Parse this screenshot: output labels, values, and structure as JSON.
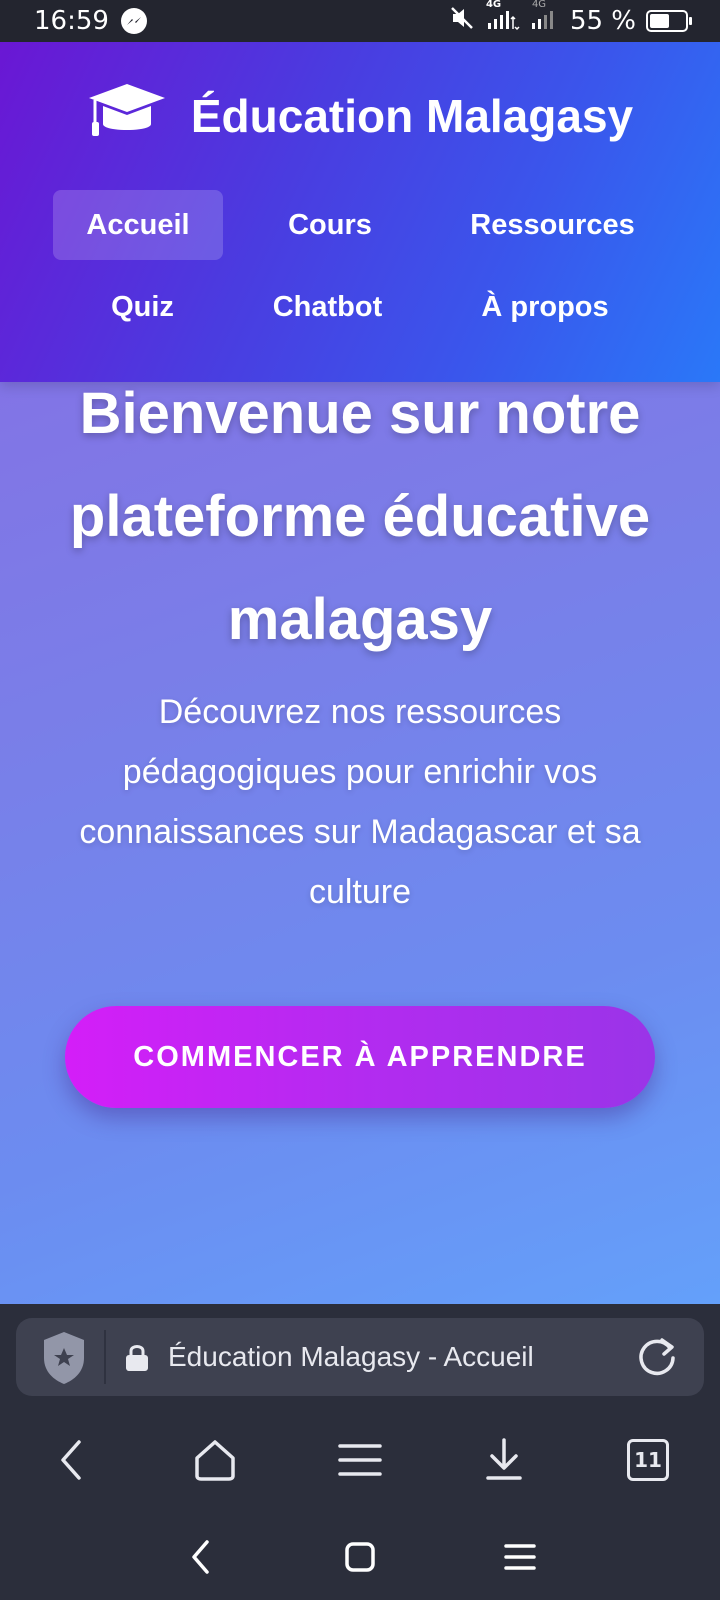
{
  "status_bar": {
    "time": "16:59",
    "battery_text": "55 %",
    "battery_level": 0.55,
    "network_label_1": "4G",
    "network_label_2": "4G"
  },
  "header": {
    "brand": "Éducation Malagasy",
    "nav": [
      {
        "label": "Accueil",
        "active": true
      },
      {
        "label": "Cours",
        "active": false
      },
      {
        "label": "Ressources",
        "active": false
      },
      {
        "label": "Quiz",
        "active": false
      },
      {
        "label": "Chatbot",
        "active": false
      },
      {
        "label": "À propos",
        "active": false
      }
    ]
  },
  "hero": {
    "title_lines": [
      "Bienvenue sur notre",
      "plateforme éducative",
      "malagasy"
    ],
    "subtitle_lines": [
      "Découvrez nos ressources",
      "pédagogiques pour enrichir vos",
      "connaissances sur Madagascar et sa",
      "culture"
    ],
    "cta_label": "COMMENCER À APPRENDRE"
  },
  "browser": {
    "url_title": "Éducation Malagasy - Accueil",
    "tab_count": "11"
  },
  "colors": {
    "cta_start": "#d41ef8",
    "cta_end": "#9a34e8",
    "header_start": "#6a17d4",
    "header_end": "#2a78f8"
  }
}
